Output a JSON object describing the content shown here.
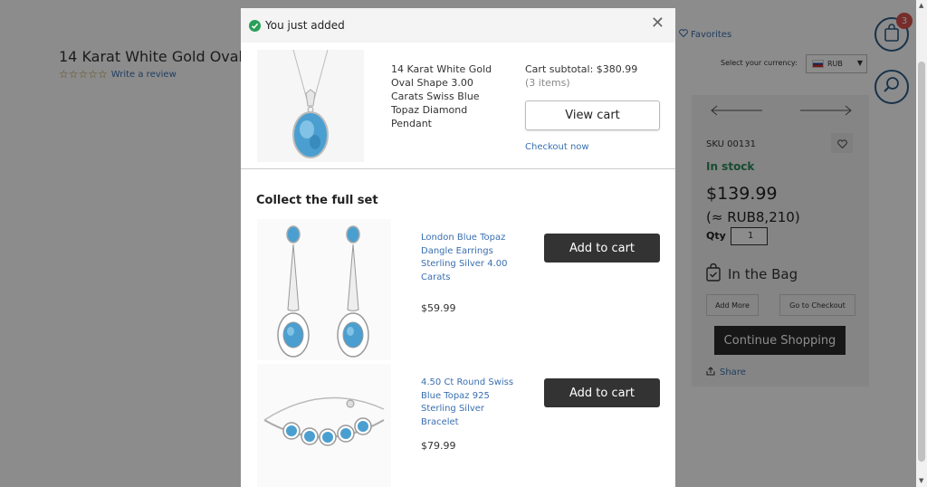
{
  "background": {
    "product_title": "14 Karat White Gold Oval S",
    "write_review": "Write a review",
    "stars": "☆☆☆☆☆",
    "favorites": "Favorites",
    "currency_label": "Select your currency:",
    "currency_value": "RUB",
    "cart_count": "3",
    "sku": "SKU 00131",
    "stock": "In stock",
    "price": "$139.99",
    "converted_price": "(≈ RUB8,210)",
    "qty_label": "Qty",
    "qty_value": "1",
    "in_bag": "In the Bag",
    "add_more": "Add More",
    "go_to_checkout": "Go to Checkout",
    "continue_shopping": "Continue Shopping",
    "share": "Share"
  },
  "modal": {
    "title": "You just added",
    "added_item": {
      "name": "14 Karat White Gold Oval Shape 3.00 Carats Swiss Blue Topaz Diamond Pendant"
    },
    "cart_subtotal": "Cart subtotal: $380.99",
    "cart_items": "(3 items)",
    "view_cart": "View cart",
    "checkout_now": "Checkout now",
    "collect_title": "Collect the full set",
    "set_items": [
      {
        "name": "London Blue Topaz Dangle Earrings Sterling Silver 4.00 Carats",
        "price": "$59.99",
        "button": "Add to cart"
      },
      {
        "name": "4.50 Ct Round Swiss Blue Topaz 925 Sterling Silver Bracelet",
        "price": "$79.99",
        "button": "Add to cart"
      }
    ]
  },
  "colors": {
    "accent_link": "#3a6fb0",
    "success": "#2aa05a",
    "dark_button": "#333333",
    "badge": "#d9534f",
    "topaz": "#4a9fd0"
  }
}
